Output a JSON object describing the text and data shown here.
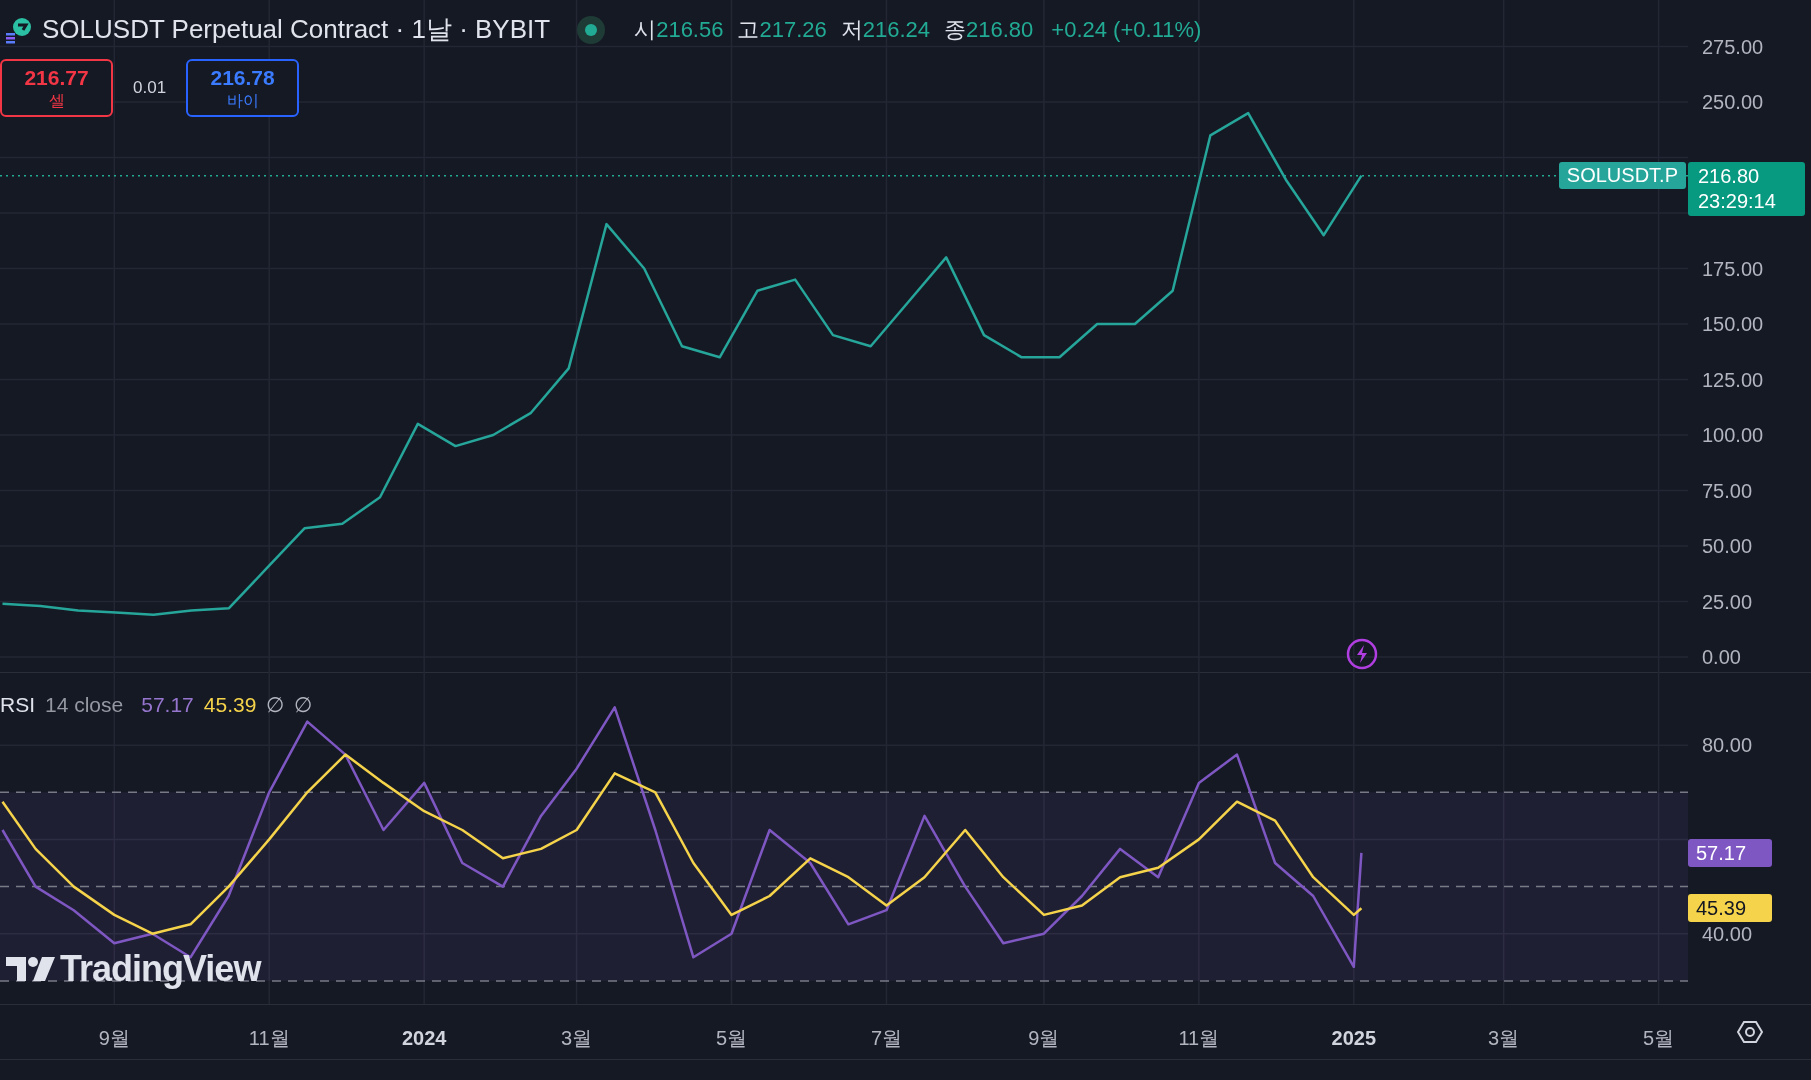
{
  "header": {
    "title": "SOLUSDT Perpetual Contract · 1날 · BYBIT",
    "ohlc": [
      {
        "label": "시",
        "value": "216.56"
      },
      {
        "label": "고",
        "value": "217.26"
      },
      {
        "label": "저",
        "value": "216.24"
      },
      {
        "label": "종",
        "value": "216.80"
      }
    ],
    "change": "+0.24 (+0.11%)"
  },
  "trade": {
    "sell": {
      "price": "216.77",
      "label": "셀"
    },
    "spread": "0.01",
    "buy": {
      "price": "216.78",
      "label": "바이"
    }
  },
  "price_pane": {
    "chart_data": {
      "type": "line",
      "grid": true,
      "ylim": [
        -7.2,
        295.96
      ],
      "ref_lines": [
        {
          "axis": "y",
          "value": 216.8,
          "color": "#22ab94"
        }
      ],
      "yticks": [
        {
          "value": 0,
          "label": "0.00"
        },
        {
          "value": 25,
          "label": "25.00"
        },
        {
          "value": 50,
          "label": "50.00"
        },
        {
          "value": 75,
          "label": "75.00"
        },
        {
          "value": 100,
          "label": "100.00"
        },
        {
          "value": 125,
          "label": "125.00"
        },
        {
          "value": 150,
          "label": "150.00"
        },
        {
          "value": 175,
          "label": "175.00"
        },
        {
          "value": 250,
          "label": "250.00"
        },
        {
          "value": 275,
          "label": "275.00"
        }
      ],
      "categories": [
        null,
        null,
        null,
        null,
        null,
        null,
        null,
        null,
        null,
        null,
        null,
        null,
        null,
        null,
        null,
        null,
        null,
        null,
        null,
        null,
        null,
        null,
        null,
        null,
        null,
        null,
        null,
        null,
        null,
        null,
        null,
        null,
        null,
        null,
        null,
        null,
        null
      ],
      "series": [
        {
          "name": "SOLUSDT.P",
          "color": "#26a69a",
          "values": [
            24,
            23,
            21,
            20,
            19,
            21,
            22,
            40,
            58,
            60,
            72,
            105,
            95,
            100,
            110,
            130,
            195,
            175,
            140,
            135,
            165,
            170,
            145,
            140,
            160,
            180,
            145,
            135,
            135,
            150,
            150,
            165,
            235,
            245,
            215,
            190,
            216.8
          ]
        }
      ]
    },
    "price_tag": "216.80",
    "countdown": "23:29:14"
  },
  "rsi_pane": {
    "legend": {
      "params": "14 close",
      "value": "57.17",
      "ma_value": "45.39",
      "extras": [
        "∅",
        "∅"
      ]
    },
    "chart_data": {
      "type": "line",
      "grid": true,
      "xlim": [
        "2023-07-18",
        "2025-06-30"
      ],
      "ylim": [
        25.1,
        95.3
      ],
      "bands": [
        {
          "axis": "y",
          "from": 30,
          "to": 70,
          "color": "#7e57c2"
        }
      ],
      "ref_lines": [
        {
          "axis": "y",
          "value": 70,
          "color": "#787b86"
        },
        {
          "axis": "y",
          "value": 50,
          "color": "#787b86"
        },
        {
          "axis": "y",
          "value": 30,
          "color": "#787b86"
        }
      ],
      "yticks": [
        {
          "value": 40,
          "label": "40.00"
        },
        {
          "value": 80,
          "label": "80.00"
        }
      ],
      "xticks": [
        {
          "value": "2023-09-01",
          "label": "9월"
        },
        {
          "value": "2023-11-01",
          "label": "11월"
        },
        {
          "value": "2024-01-01",
          "label": "2024"
        },
        {
          "value": "2024-03-01",
          "label": "3월"
        },
        {
          "value": "2024-05-01",
          "label": "5월"
        },
        {
          "value": "2024-07-01",
          "label": "7월"
        },
        {
          "value": "2024-09-01",
          "label": "9월"
        },
        {
          "value": "2024-11-01",
          "label": "11월"
        },
        {
          "value": "2025-01-01",
          "label": "2025"
        },
        {
          "value": "2025-03-01",
          "label": "3월"
        },
        {
          "value": "2025-05-01",
          "label": "5월"
        }
      ],
      "x": [
        "2023-07-19",
        "2023-08-01",
        "2023-08-16",
        "2023-09-01",
        "2023-09-16",
        "2023-10-01",
        "2023-10-16",
        "2023-11-01",
        "2023-11-16",
        "2023-12-01",
        "2023-12-16",
        "2024-01-01",
        "2024-01-16",
        "2024-02-01",
        "2024-02-16",
        "2024-03-01",
        "2024-03-16",
        "2024-04-01",
        "2024-04-16",
        "2024-05-01",
        "2024-05-16",
        "2024-06-01",
        "2024-06-16",
        "2024-07-01",
        "2024-07-16",
        "2024-08-01",
        "2024-08-16",
        "2024-09-01",
        "2024-09-16",
        "2024-10-01",
        "2024-10-16",
        "2024-11-01",
        "2024-11-16",
        "2024-12-01",
        "2024-12-16",
        "2025-01-01",
        "2025-01-04"
      ],
      "series": [
        {
          "name": "RSI",
          "color": "#7e57c2",
          "values": [
            62,
            50,
            45,
            38,
            40,
            35,
            48,
            70,
            85,
            78,
            62,
            72,
            55,
            50,
            65,
            75,
            88,
            62,
            35,
            40,
            62,
            55,
            42,
            45,
            65,
            50,
            38,
            40,
            48,
            58,
            52,
            72,
            78,
            55,
            48,
            33,
            57.17
          ]
        },
        {
          "color": "#f5d34a",
          "values": [
            68,
            58,
            50,
            44,
            40,
            42,
            50,
            60,
            70,
            78,
            72,
            66,
            62,
            56,
            58,
            62,
            74,
            70,
            55,
            44,
            48,
            56,
            52,
            46,
            52,
            62,
            52,
            44,
            46,
            52,
            54,
            60,
            68,
            64,
            52,
            44,
            45.39
          ]
        }
      ]
    },
    "value_tag": "57.17",
    "ma_tag": "45.39"
  },
  "branding": "TradingView"
}
